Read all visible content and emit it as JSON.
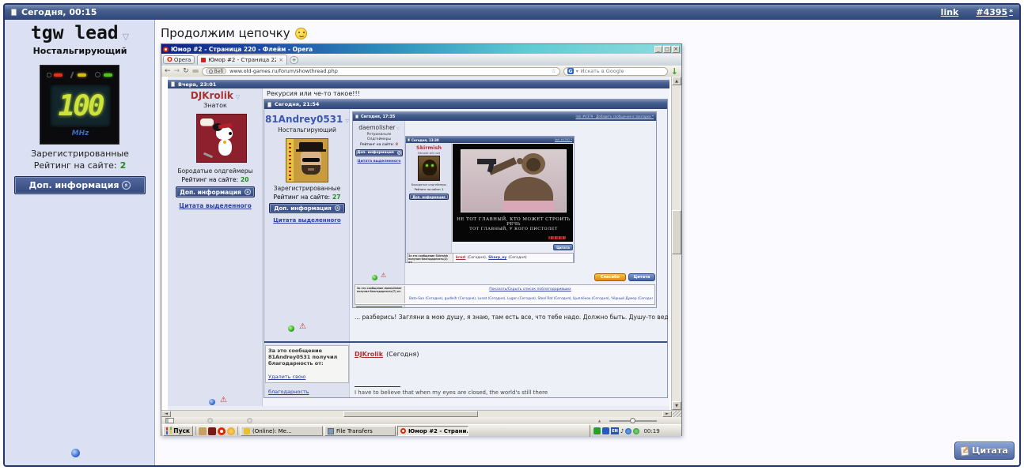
{
  "topbar": {
    "date": "Сегодня, 00:15",
    "link_label": "link",
    "post_number": "#4395",
    "asterisk": "*"
  },
  "sidebar": {
    "username": "tgw lead",
    "user_title": "Ностальгирующий",
    "avatar_digits": "100",
    "avatar_unit": "MHz",
    "group": "Зарегистрированные",
    "rating_label": "Рейтинг на сайте:",
    "rating_value": "2",
    "info_button": "Доп. информация"
  },
  "message": {
    "text": "Продолжим цепочку"
  },
  "outer_quote_button": "Цитата",
  "opera": {
    "window_title": "Юмор #2 - Страница 220 - Флейм - Opera",
    "menu_button": "Opera",
    "tab_title": "Юмор #2 - Страница 22...",
    "web_badge": "Веб",
    "url": "www.old-games.ru/forum/showthread.php",
    "search_placeholder": "Искать в Google"
  },
  "post1": {
    "date": "Вчера, 23:01",
    "author": "DJKrolik",
    "rank": "Знаток",
    "group": "Бородатые олдгеймеры",
    "rating_label": "Рейтинг на сайте:",
    "rating_value": "20",
    "info_button": "Доп. информация",
    "quote_selected": "Цитата выделенного",
    "subject": "Рекурсия или че-то такое!!!"
  },
  "post2": {
    "date": "Сегодня, 21:54",
    "author": "81Andrey0531",
    "rank": "Ностальгирующий",
    "group": "Зарегистрированные",
    "rating_label": "Рейтинг на сайте:",
    "rating_value": "27",
    "info_button": "Доп. информация",
    "quote_selected": "Цитата выделенного",
    "body_text": "... разберись! Загляни в мою душу, я знаю, там есть все, что тебе надо. Должно быть. Душу-то ведь я никогда и никому не пр",
    "thanks_label": "За это сообщение 81Andrey0531 получил благодарность от:",
    "thanks_remove_link": "Удалить свою благодарность",
    "thanked_by": "DJKrolik",
    "thanked_when": "(Сегодня)",
    "signature": "I have to believe that when my eyes are closed, the world's still there"
  },
  "post3": {
    "date": "Сегодня, 17:35",
    "header_links": "link  #4379 · Добавить сообщение в закладки *",
    "author": "daemolisher",
    "rank_line1": "Ретроманьяк",
    "rank_line2": "Олдгеймеры",
    "rating_label": "Рейтинг на сайте:",
    "rating_value": "8",
    "info_button": "Доп. информация",
    "quote_selected": "Цитата выделенного",
    "thanks_button": "Спасибо",
    "quote_button": "Цитата",
    "thanks_label": "За это сообщение daemolisher получил благодарность(7) от:",
    "thanks_toggle_link": "Показать/Скрыть список поблагодаривших",
    "thanks_list": "Bato-San (Сегодня), gudleifr (Сегодня), Lunat (Сегодня), Lugan (Сегодня), Steel Rat (Сегодня), Цыплёнок (Сегодня), Чёрный Думер (Сегодня)"
  },
  "post4": {
    "date": "Сегодня, 13:30",
    "header_links": "link  #4392 *",
    "author": "Skirmish",
    "rank": "Sibcode will rule",
    "group": "Бородатые олдгеймеры",
    "rating_label": "Рейтинг на сайте:",
    "rating_value": "1",
    "info_button": "Доп. информация",
    "quote_button": "Цитата",
    "demotivator_line1": "НЕ ТОТ ГЛАВНЫЙ, КТО МОЖЕТ СТРОИТЬ РЕЧЬ",
    "demotivator_line2": "ТОТ ГЛАВНЫЙ, У КОГО ПИСТОЛЕТ",
    "thanks_label": "За это сообщение Skirmish получил благодарность(2) от:",
    "thanks_name1": "krezl",
    "thanks_when1": "(Сегодня),",
    "thanks_name2": "Sharp_ey",
    "thanks_when2": "(Сегодня)"
  },
  "taskbar": {
    "start_label": "Пуск",
    "task_online": "(Online): Me...",
    "task_transfers": "File Transfers",
    "task_opera": "Юмор #2 - Страни...",
    "lang": "EN",
    "clock": "00:19"
  },
  "icons": {
    "dropdown": "▽",
    "close": "×",
    "minimize": "_",
    "restore": "□",
    "back": "←",
    "forward": "→",
    "reload": "↻",
    "star": "☆",
    "caret": "▾",
    "green_arrow": "↓",
    "warning": "⚠",
    "up": "▲",
    "down": "▼",
    "left": "◄",
    "right": "►",
    "plus": "+",
    "opera_o": "O",
    "google_g": "G",
    "note": "♪",
    "collapse": "«"
  }
}
